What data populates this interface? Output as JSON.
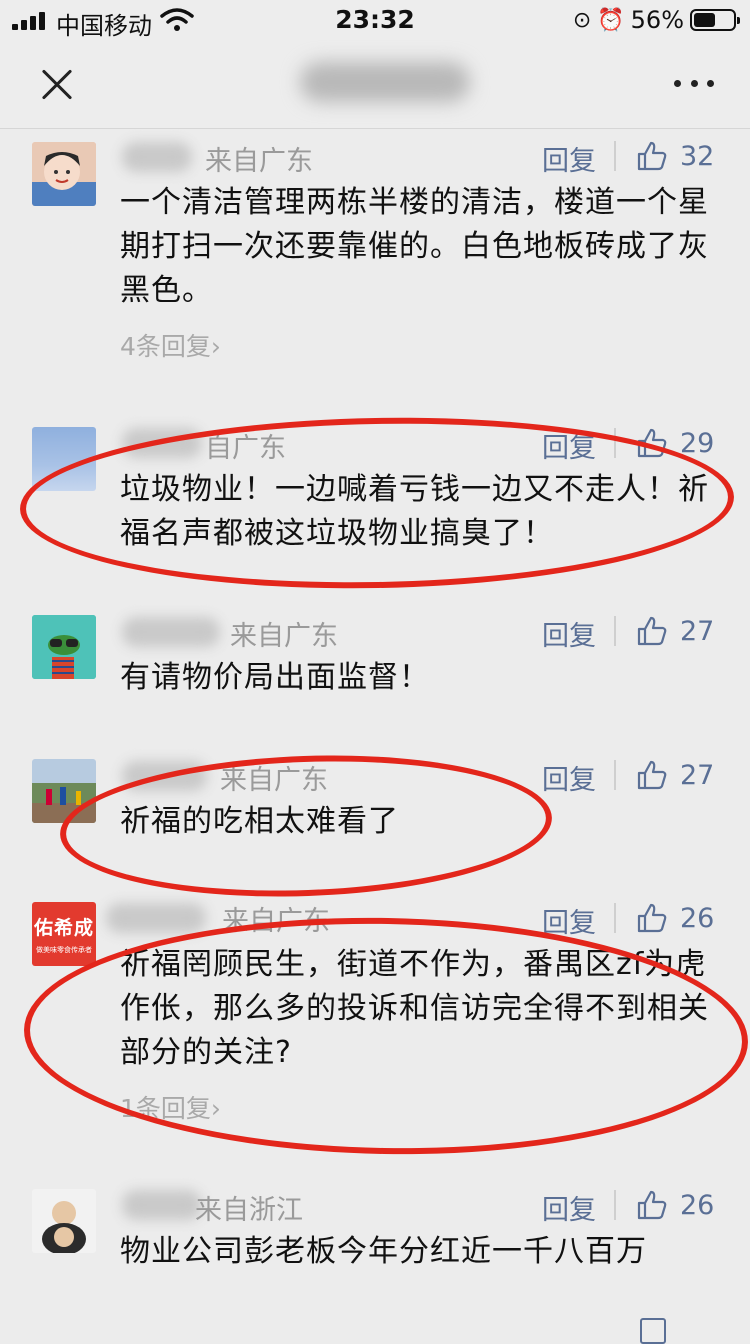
{
  "status_bar": {
    "carrier": "中国移动",
    "time": "23:32",
    "battery_percent": "56%",
    "battery_level": 0.56,
    "icons": [
      "signal-icon",
      "wifi-icon",
      "orientation-lock-icon",
      "alarm-icon",
      "battery-icon"
    ]
  },
  "nav": {
    "close_icon": "close-icon",
    "more_icon": "more-icon",
    "title_blurred": true
  },
  "colors": {
    "background": "#ececec",
    "link": "#5a6f95",
    "annotation": "#e3261b"
  },
  "comments": [
    {
      "location": "来自广东",
      "reply_label": "回复",
      "likes": "32",
      "content": "一个清洁管理两栋半楼的清洁，楼道一个星期打扫一次还要靠催的。白色地板砖成了灰黑色。",
      "sub_replies": "4条回复",
      "chevron": "›"
    },
    {
      "location": "自广东",
      "reply_label": "回复",
      "likes": "29",
      "content": "垃圾物业！一边喊着亏钱一边又不走人！祈福名声都被这垃圾物业搞臭了！"
    },
    {
      "location": "来自广东",
      "reply_label": "回复",
      "likes": "27",
      "content": "有请物价局出面监督！"
    },
    {
      "location": "来自广东",
      "reply_label": "回复",
      "likes": "27",
      "content": "祈福的吃相太难看了"
    },
    {
      "avatar_text": "佑希成",
      "avatar_subtext": "做美味零食传承者",
      "location": "来自广东",
      "reply_label": "回复",
      "likes": "26",
      "content": "祈福罔顾民生，街道不作为，番禺区zf为虎作伥，那么多的投诉和信访完全得不到相关部分的关注?",
      "sub_replies": "1条回复",
      "chevron": "›"
    },
    {
      "location": "来自浙江",
      "reply_label": "回复",
      "likes": "26",
      "content": "物业公司彭老板今年分红近一千八百万"
    }
  ]
}
